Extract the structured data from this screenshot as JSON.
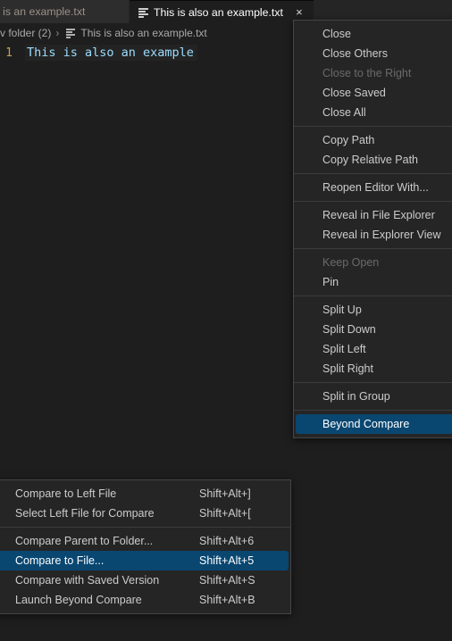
{
  "editor": {
    "tabs": [
      {
        "label": "his is an example.txt",
        "active": false,
        "icon": "text-file-icon"
      },
      {
        "label": "This is also an example.txt",
        "active": true,
        "icon": "text-file-icon"
      }
    ],
    "tab_close_glyph": "×",
    "breadcrumb": {
      "folder": "v folder (2)",
      "separator": "›",
      "file": "This is also an example.txt"
    },
    "code": {
      "line_number": "1",
      "line_text": "This is also an example"
    }
  },
  "context_menu": {
    "name": "editor-tab-context-menu",
    "groups": [
      {
        "items": [
          {
            "label": "Close",
            "disabled": false,
            "selected": false
          },
          {
            "label": "Close Others",
            "disabled": false,
            "selected": false
          },
          {
            "label": "Close to the Right",
            "disabled": true,
            "selected": false
          },
          {
            "label": "Close Saved",
            "disabled": false,
            "selected": false
          },
          {
            "label": "Close All",
            "disabled": false,
            "selected": false
          }
        ]
      },
      {
        "items": [
          {
            "label": "Copy Path",
            "disabled": false,
            "selected": false
          },
          {
            "label": "Copy Relative Path",
            "disabled": false,
            "selected": false
          }
        ]
      },
      {
        "items": [
          {
            "label": "Reopen Editor With...",
            "disabled": false,
            "selected": false
          }
        ]
      },
      {
        "items": [
          {
            "label": "Reveal in File Explorer",
            "disabled": false,
            "selected": false
          },
          {
            "label": "Reveal in Explorer View",
            "disabled": false,
            "selected": false
          }
        ]
      },
      {
        "items": [
          {
            "label": "Keep Open",
            "disabled": true,
            "selected": false
          },
          {
            "label": "Pin",
            "disabled": false,
            "selected": false
          }
        ]
      },
      {
        "items": [
          {
            "label": "Split Up",
            "disabled": false,
            "selected": false
          },
          {
            "label": "Split Down",
            "disabled": false,
            "selected": false
          },
          {
            "label": "Split Left",
            "disabled": false,
            "selected": false
          },
          {
            "label": "Split Right",
            "disabled": false,
            "selected": false
          }
        ]
      },
      {
        "items": [
          {
            "label": "Split in Group",
            "disabled": false,
            "selected": false
          }
        ]
      },
      {
        "items": [
          {
            "label": "Beyond Compare",
            "disabled": false,
            "selected": true
          }
        ]
      }
    ]
  },
  "submenu": {
    "name": "beyond-compare-submenu",
    "groups": [
      {
        "items": [
          {
            "label": "Compare to Left File",
            "keybind": "Shift+Alt+]",
            "disabled": false,
            "selected": false
          },
          {
            "label": "Select Left File for Compare",
            "keybind": "Shift+Alt+[",
            "disabled": false,
            "selected": false
          }
        ]
      },
      {
        "items": [
          {
            "label": "Compare Parent to Folder...",
            "keybind": "Shift+Alt+6",
            "disabled": false,
            "selected": false
          },
          {
            "label": "Compare to File...",
            "keybind": "Shift+Alt+5",
            "disabled": false,
            "selected": true
          },
          {
            "label": "Compare with Saved Version",
            "keybind": "Shift+Alt+S",
            "disabled": false,
            "selected": false
          },
          {
            "label": "Launch Beyond Compare",
            "keybind": "Shift+Alt+B",
            "disabled": false,
            "selected": false
          }
        ]
      }
    ]
  },
  "colors": {
    "editor_background": "#1e1e1e",
    "tabbar_background": "#252526",
    "inactive_tab_background": "#2d2d2d",
    "menu_background": "#252526",
    "menu_border": "#454545",
    "selection_blue": "#094771",
    "menu_text": "#cccccc",
    "menu_text_disabled": "#6a6a6a",
    "code_string_blue": "#9cdcfe",
    "line_number_gold": "#c6a25a"
  }
}
